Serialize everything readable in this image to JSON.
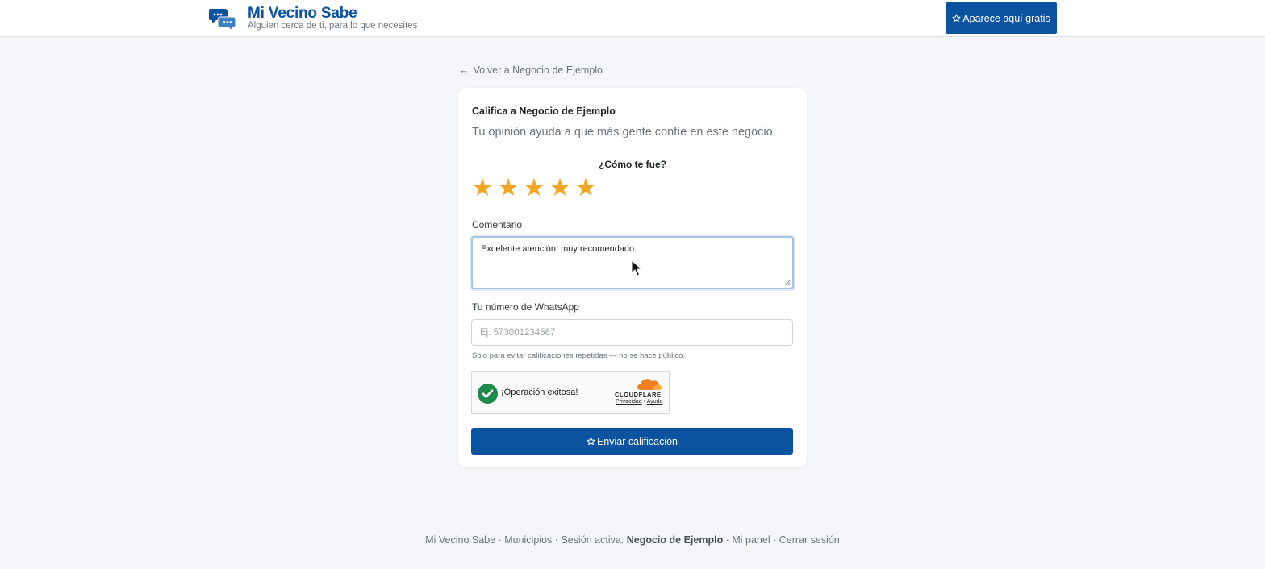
{
  "header": {
    "brand_name": "Mi Vecino Sabe",
    "tagline": "Alguien cerca de ti, para lo que necesites",
    "cta_label": "Aparece aquí gratis",
    "cta_icon": "star-outline-icon"
  },
  "back_link": {
    "icon": "arrow-left-icon",
    "label": "Volver a Negocio de Ejemplo"
  },
  "form": {
    "title": "Califica a Negocio de Ejemplo",
    "subtitle": "Tu opinión ayuda a que más gente confíe en este negocio.",
    "rating_question": "¿Cómo te fue?",
    "rating": 5,
    "rating_max": 5,
    "comment_label": "Comentario",
    "comment_value": "Excelente atención, muy recomendado.",
    "whatsapp_label": "Tu número de WhatsApp",
    "whatsapp_placeholder": "Ej. 573001234567",
    "whatsapp_value": "",
    "whatsapp_help": "Solo para evitar calificaciones repetidas — no se hace público.",
    "submit_label": "Enviar calificación"
  },
  "captcha": {
    "status_text": "¡Operación exitosa!",
    "provider": "CLOUDFLARE",
    "privacy_link": "Privacidad",
    "separator": "•",
    "help_link": "Ayuda"
  },
  "footer": {
    "brand": "Mi Vecino Sabe",
    "municipios": "Municipios",
    "session_prefix": "Sesión activa:",
    "session_name": "Negocio de Ejemplo",
    "panel": "Mi panel",
    "logout": "Cerrar sesión",
    "sep": "·"
  },
  "colors": {
    "primary": "#0b53a1",
    "star": "#f4a623",
    "success": "#1f8a4c",
    "cloudflare": "#f38020",
    "background": "#f4f6f9"
  }
}
